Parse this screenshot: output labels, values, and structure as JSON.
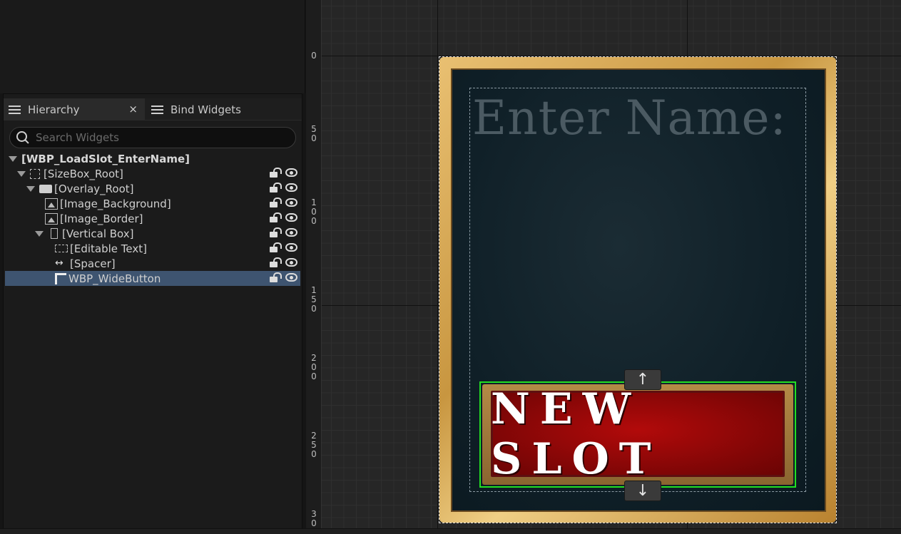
{
  "tabs": {
    "hierarchy": "Hierarchy",
    "close": "×",
    "bind_widgets": "Bind Widgets"
  },
  "search": {
    "placeholder": "Search Widgets"
  },
  "tree": [
    {
      "label": "[WBP_LoadSlot_EnterName]",
      "icon": "root-widget",
      "selected": false
    },
    {
      "label": "[SizeBox_Root]",
      "icon": "sizebox-icon",
      "selected": false
    },
    {
      "label": "[Overlay_Root]",
      "icon": "overlay-icon",
      "selected": false
    },
    {
      "label": "[Image_Background]",
      "icon": "image-icon",
      "selected": false
    },
    {
      "label": "[Image_Border]",
      "icon": "image-icon",
      "selected": false
    },
    {
      "label": "[Vertical Box]",
      "icon": "vertical-box-icon",
      "selected": false
    },
    {
      "label": "[Editable Text]",
      "icon": "editable-text-icon",
      "selected": false
    },
    {
      "label": "[Spacer]",
      "icon": "spacer-icon",
      "selected": false
    },
    {
      "label": "WBP_WideButton",
      "icon": "user-widget-icon",
      "selected": true
    }
  ],
  "ruler": {
    "ticks": [
      {
        "text": "0"
      },
      {
        "text": "5\n0"
      },
      {
        "text": "1\n0\n0"
      },
      {
        "text": "1\n5\n0"
      },
      {
        "text": "2\n0\n0"
      },
      {
        "text": "2\n5\n0"
      },
      {
        "text": "3\n0"
      }
    ]
  },
  "preview": {
    "editable_text": "Enter Name:",
    "button_label": "NEW SLOT",
    "nudge_up": "↑",
    "nudge_down": "↓"
  },
  "colors": {
    "selection_row": "#3e5470",
    "selection_outline": "#22e022",
    "button_red": "#9e0909",
    "frame_gold": "#d9aa5a"
  }
}
